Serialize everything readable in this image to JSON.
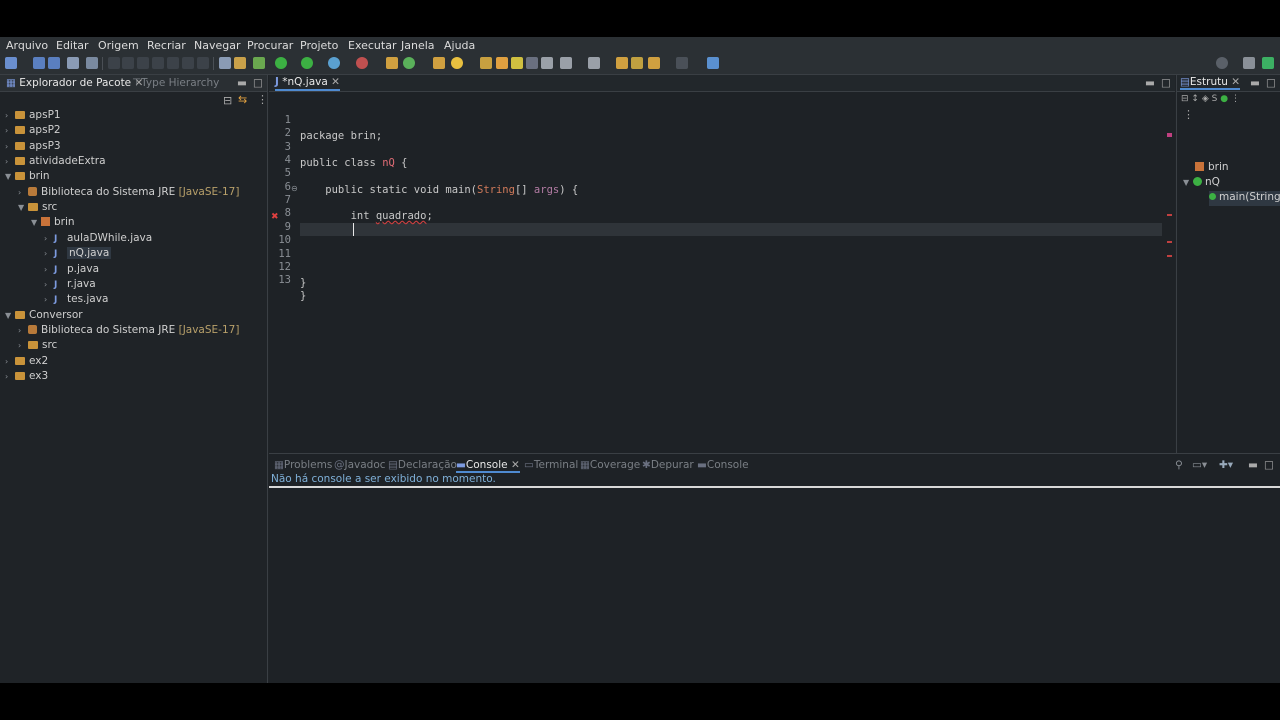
{
  "menu": [
    "Arquivo",
    "Editar",
    "Origem",
    "Recriar",
    "Navegar",
    "Procurar",
    "Projeto",
    "Executar",
    "Janela",
    "Ajuda"
  ],
  "left_panel": {
    "tabs": [
      "Explorador de Pacote",
      "Type Hierarchy"
    ],
    "tree": [
      {
        "label": "apsP1",
        "indent": 0,
        "icon": "project-folder-icon",
        "expanded": false
      },
      {
        "label": "apsP2",
        "indent": 0,
        "icon": "project-folder-icon",
        "expanded": false
      },
      {
        "label": "apsP3",
        "indent": 0,
        "icon": "project-folder-icon",
        "expanded": false
      },
      {
        "label": "atividadeExtra",
        "indent": 0,
        "icon": "project-folder-icon",
        "expanded": false
      },
      {
        "label": "brin",
        "indent": 0,
        "icon": "project-folder-icon",
        "expanded": true
      },
      {
        "label": "Biblioteca do Sistema JRE",
        "suffix": "[JavaSE-17]",
        "indent": 1,
        "icon": "library-icon",
        "expanded": false
      },
      {
        "label": "src",
        "indent": 1,
        "icon": "source-folder-icon",
        "expanded": true
      },
      {
        "label": "brin",
        "indent": 2,
        "icon": "package-icon",
        "expanded": true
      },
      {
        "label": "aulaDWhile.java",
        "indent": 3,
        "icon": "java-file-icon",
        "expanded": false
      },
      {
        "label": "nQ.java",
        "indent": 3,
        "icon": "java-file-icon",
        "expanded": false,
        "selected": true
      },
      {
        "label": "p.java",
        "indent": 3,
        "icon": "java-file-icon",
        "expanded": false
      },
      {
        "label": "r.java",
        "indent": 3,
        "icon": "java-file-icon",
        "expanded": false
      },
      {
        "label": "tes.java",
        "indent": 3,
        "icon": "java-file-icon",
        "expanded": false
      },
      {
        "label": "Conversor",
        "indent": 0,
        "icon": "project-folder-icon",
        "expanded": true
      },
      {
        "label": "Biblioteca do Sistema JRE",
        "suffix": "[JavaSE-17]",
        "indent": 1,
        "icon": "library-icon",
        "expanded": false
      },
      {
        "label": "src",
        "indent": 1,
        "icon": "source-folder-icon",
        "expanded": false
      },
      {
        "label": "ex2",
        "indent": 0,
        "icon": "project-folder-icon",
        "expanded": false
      },
      {
        "label": "ex3",
        "indent": 0,
        "icon": "project-folder-icon",
        "expanded": false
      }
    ]
  },
  "editor": {
    "tab_label": "*nQ.java",
    "line_numbers": [
      "1",
      "2",
      "3",
      "4",
      "5",
      "6",
      "7",
      "8",
      "9",
      "10",
      "11",
      "12",
      "13"
    ],
    "lines": {
      "l1": "package brin;",
      "l3a": "public class ",
      "l3b": "nQ",
      "l3c": " {",
      "l5a": "    public static void main(",
      "l5b": "String",
      "l5c": "[] ",
      "l5d": "args",
      "l5e": ") {",
      "l7a": "        int ",
      "l7b": "quadrado",
      "l7c": ";",
      "l12": "}",
      "l13": "}"
    }
  },
  "outline": {
    "tab_label": "Estrutu",
    "items": [
      "brin",
      "nQ",
      "main(String"
    ]
  },
  "console": {
    "tabs": [
      "Problems",
      "Javadoc",
      "Declaração",
      "Console",
      "Terminal",
      "Coverage",
      "Depurar",
      "Console"
    ],
    "message": "Não há console a ser exibido no momento."
  },
  "colors": {
    "background": "#1e2226",
    "accent": "#4f8ad0",
    "error": "#e04040"
  }
}
